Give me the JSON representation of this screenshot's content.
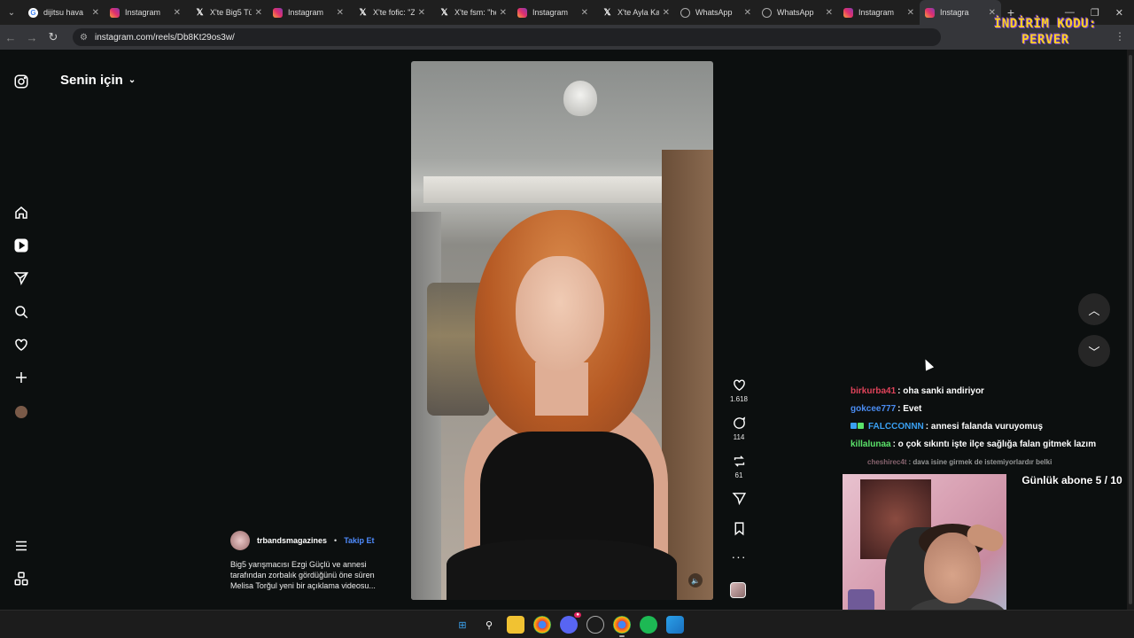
{
  "browser": {
    "tabs": [
      {
        "title": "dijitsu hava",
        "favicon": "google-icon",
        "active": false
      },
      {
        "title": "Instagram",
        "favicon": "instagram-icon",
        "active": false
      },
      {
        "title": "X'te Big5 Tü",
        "favicon": "x-icon",
        "active": false
      },
      {
        "title": "Instagram",
        "favicon": "instagram-icon",
        "active": false
      },
      {
        "title": "X'te fofic: \"Z",
        "favicon": "x-icon",
        "active": false
      },
      {
        "title": "X'te fsm: \"he",
        "favicon": "x-icon",
        "active": false
      },
      {
        "title": "Instagram",
        "favicon": "instagram-icon",
        "active": false
      },
      {
        "title": "X'te Ayla Ka",
        "favicon": "x-icon",
        "active": false
      },
      {
        "title": "WhatsApp",
        "favicon": "whatsapp-icon",
        "active": false
      },
      {
        "title": "WhatsApp",
        "favicon": "whatsapp-icon",
        "active": false
      },
      {
        "title": "Instagram",
        "favicon": "instagram-icon",
        "active": false
      },
      {
        "title": "Instagra",
        "favicon": "instagram-icon",
        "active": true
      }
    ],
    "url": "instagram.com/reels/Db8Kt29os3w/"
  },
  "promo": {
    "line1": "İNDİRİM KODU:",
    "line2": "PERVER"
  },
  "instagram": {
    "feed_title": "Senin için",
    "reel": {
      "likes": "1.618",
      "comments": "114",
      "reposts": "61",
      "author": "trbandsmagazines",
      "separator": "•",
      "follow_label": "Takip Et",
      "caption_line1": "Big5 yarışmacısı Ezgi Güçlü ve annesi",
      "caption_line2": "tarafından zorbalık gördüğünü öne süren",
      "caption_line3": "Melisa Torğul yeni bir açıklama videosu..."
    }
  },
  "chat": [
    {
      "user": "birkurba41",
      "color": "#e0435a",
      "text": ": oha sanki andiriyor",
      "dim": false
    },
    {
      "user": "gokcee777",
      "color": "#4a8cf2",
      "text": ": Evet",
      "dim": false
    },
    {
      "user": "FALCCONNN",
      "color": "#3aa0f2",
      "text": ": annesi falanda vuruyomuş",
      "dim": false
    },
    {
      "user": "killalunaa",
      "color": "#5be36a",
      "text": ": o çok sıkıntı işte ilçe sağlığa falan gitmek lazım",
      "dim": false
    },
    {
      "user": "cheshirec4t",
      "color": "#e6a4b8",
      "text": ": dava isine girmek de istemiyorlardır belki",
      "dim": true
    }
  ],
  "stream": {
    "sub_goal": "Günlük abone 5 / 10"
  }
}
